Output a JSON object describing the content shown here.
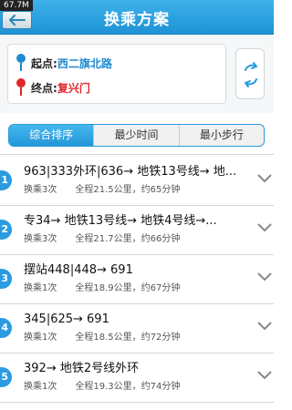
{
  "status": {
    "memory": "67.7M"
  },
  "header": {
    "title": "换乘方案"
  },
  "route": {
    "start_label": "起点:",
    "start_value": "西二旗北路",
    "end_label": "终点:",
    "end_value": "复兴门",
    "start_color": "#1f8ad0",
    "end_color": "#e0262b"
  },
  "tabs": [
    {
      "label": "综合排序",
      "active": true
    },
    {
      "label": "最少时间",
      "active": false
    },
    {
      "label": "最小步行",
      "active": false
    }
  ],
  "plans": [
    {
      "num": "1",
      "route": "963|333外环|636→ 地铁13号线→ 地...",
      "transfers": "换乘3次",
      "distance": "全程21.5公里",
      "time": "约65分钟"
    },
    {
      "num": "2",
      "route": "专34→ 地铁13号线→ 地铁4号线→...",
      "transfers": "换乘3次",
      "distance": "全程21.7公里",
      "time": "约66分钟"
    },
    {
      "num": "3",
      "route": "摆站448|448→ 691",
      "transfers": "换乘1次",
      "distance": "全程18.9公里",
      "time": "约67分钟"
    },
    {
      "num": "4",
      "route": "345|625→ 691",
      "transfers": "换乘1次",
      "distance": "全程18.5公里",
      "time": "约72分钟"
    },
    {
      "num": "5",
      "route": "392→ 地铁2号线外环",
      "transfers": "换乘1次",
      "distance": "全程19.3公里",
      "time": "约74分钟"
    }
  ],
  "colors": {
    "accent": "#2396d8",
    "number_badge": "#2a9be0"
  }
}
